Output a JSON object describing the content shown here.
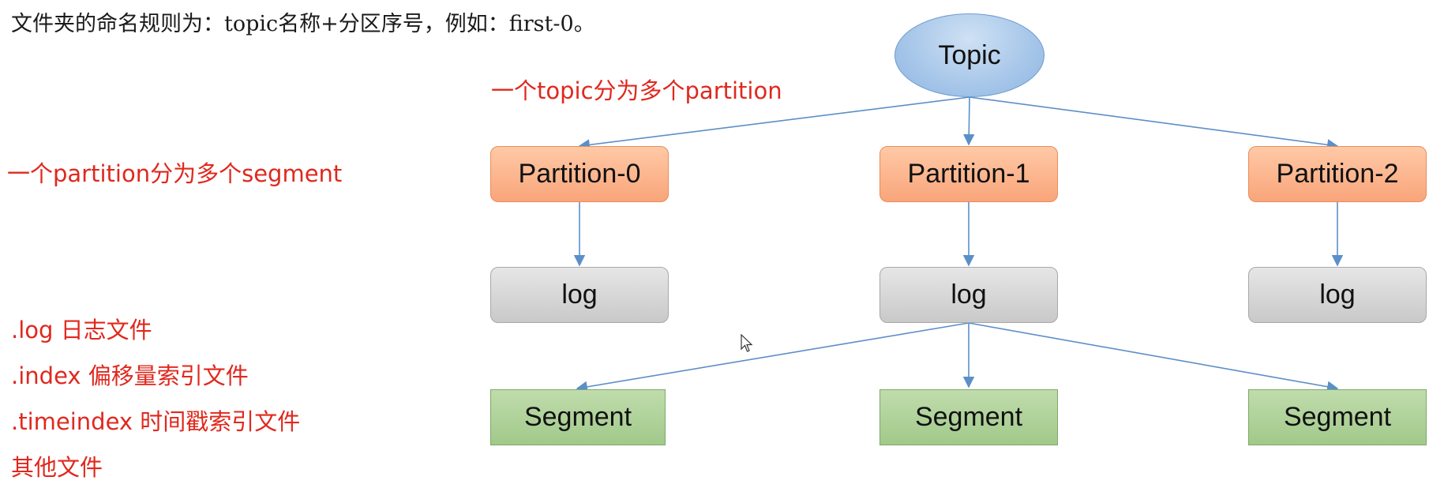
{
  "intro_text": "文件夹的命名规则为：topic名称+分区序号，例如：first-0。",
  "annotations": {
    "topic_split": "一个topic分为多个partition",
    "partition_split": "一个partition分为多个segment",
    "file_types": [
      ".log  日志文件",
      ".index 偏移量索引文件",
      ".timeindex 时间戳索引文件",
      "其他文件"
    ]
  },
  "diagram": {
    "topic": "Topic",
    "partitions": [
      "Partition-0",
      "Partition-1",
      "Partition-2"
    ],
    "logs": [
      "log",
      "log",
      "log"
    ],
    "segments": [
      "Segment",
      "Segment",
      "Segment"
    ]
  },
  "colors": {
    "annotation_red": "#e0281e",
    "topic_blue": "#a9c8ea",
    "partition_orange": "#f9a57a",
    "log_gray": "#c9c9c9",
    "segment_green": "#a1c98a",
    "connector_blue": "#5b8fc8"
  },
  "icons": [
    "mouse-pointer-icon"
  ]
}
